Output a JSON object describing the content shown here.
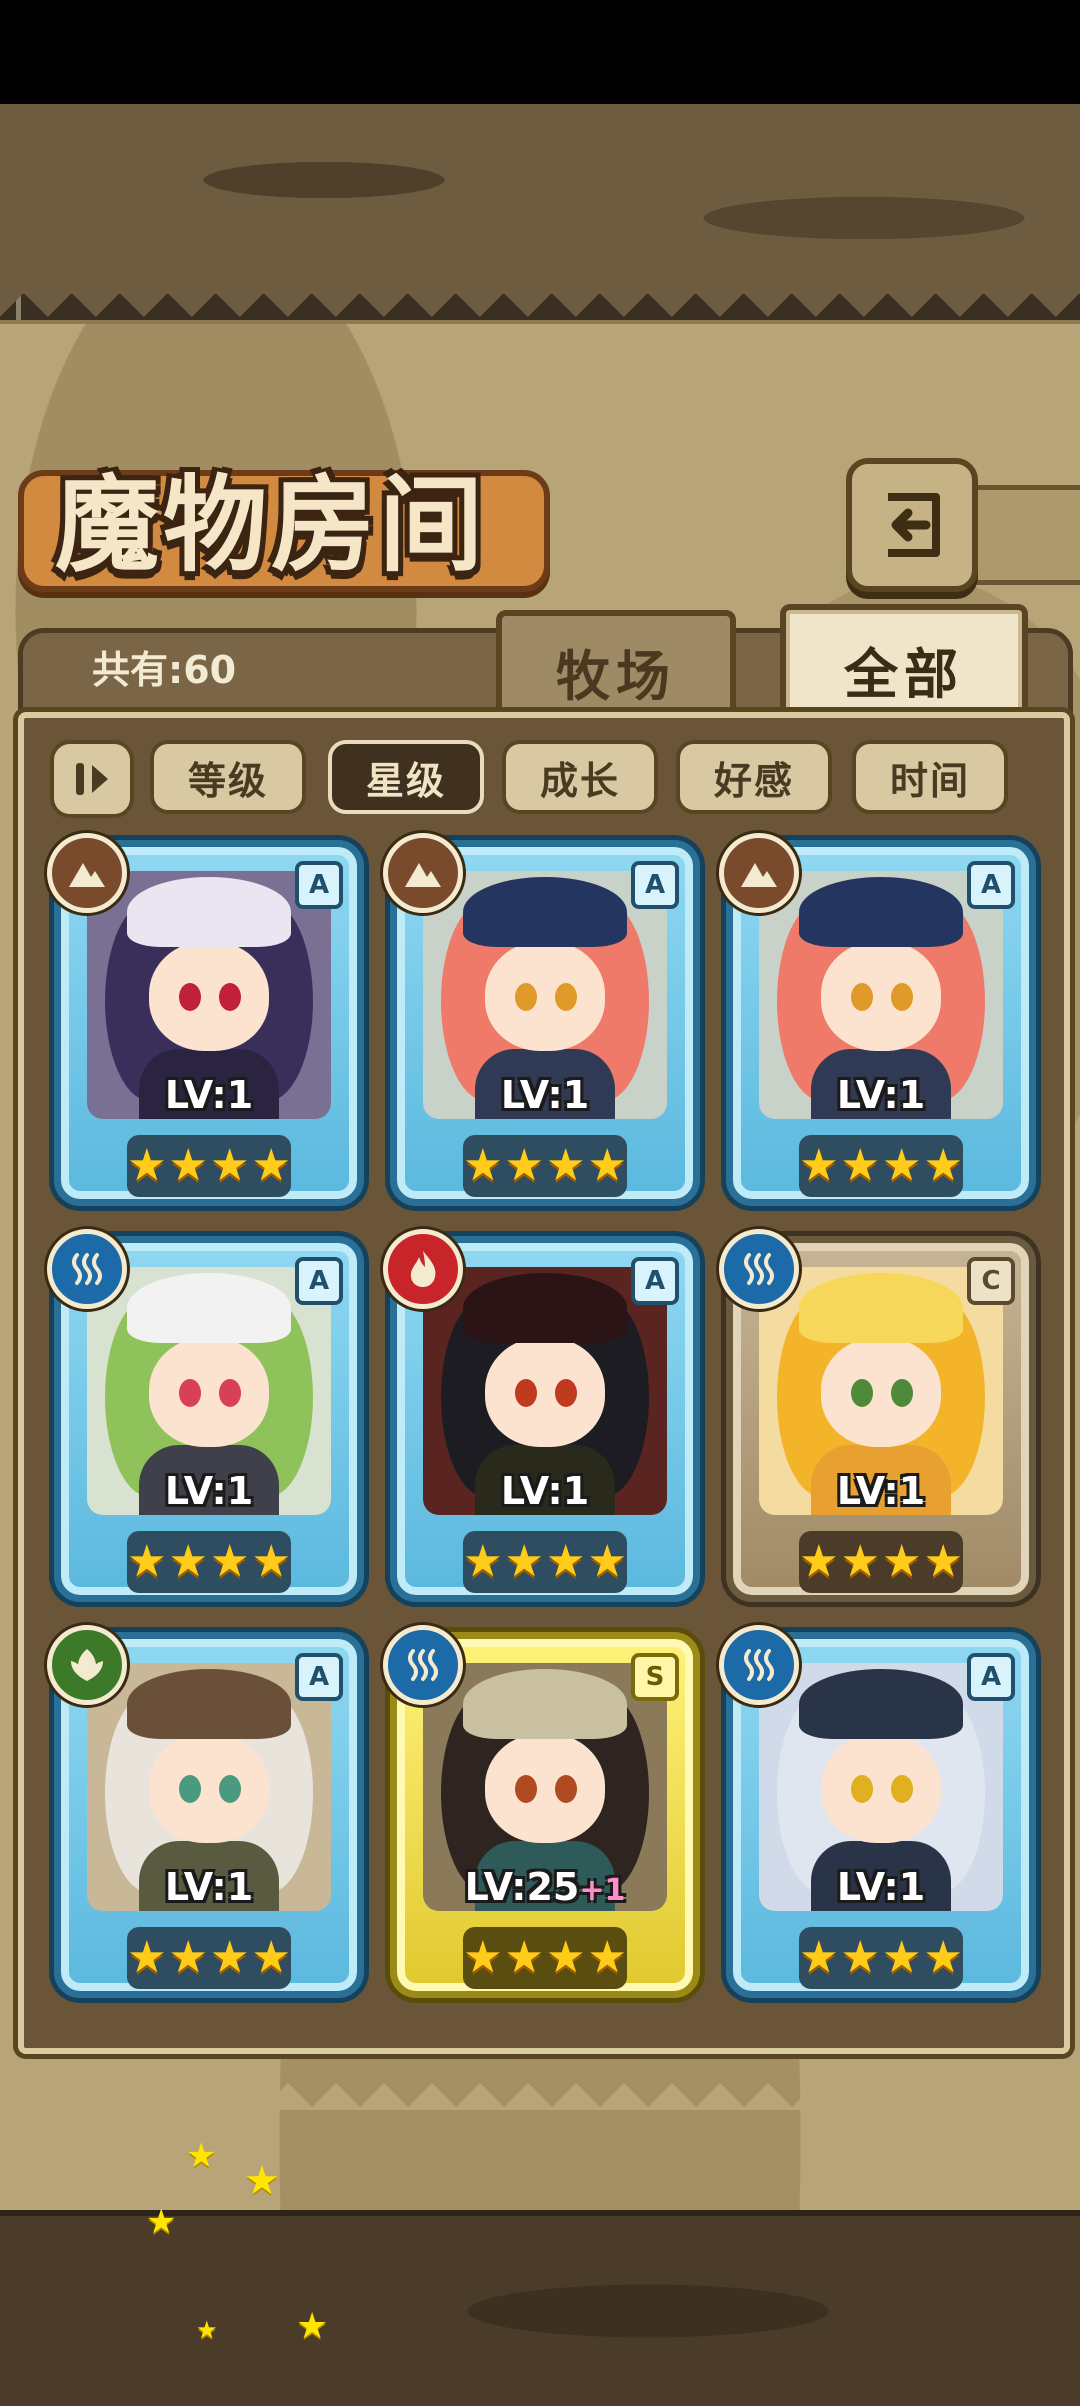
{
  "header": {
    "title": "魔物房间"
  },
  "summary": {
    "count_label": "共有:60"
  },
  "tabs": [
    {
      "label": "牧场",
      "selected": false
    },
    {
      "label": "全部",
      "selected": true
    }
  ],
  "sort": {
    "options": [
      {
        "label": "等级",
        "active": false
      },
      {
        "label": "星级",
        "active": true
      },
      {
        "label": "成长",
        "active": false
      },
      {
        "label": "好感",
        "active": false
      },
      {
        "label": "时间",
        "active": false
      }
    ]
  },
  "monsters": [
    {
      "level": "LV:1",
      "bonus": "",
      "rank": "A",
      "element": "earth-icon",
      "stars": 4,
      "frame": "blue"
    },
    {
      "level": "LV:1",
      "bonus": "",
      "rank": "A",
      "element": "earth-icon",
      "stars": 4,
      "frame": "blue"
    },
    {
      "level": "LV:1",
      "bonus": "",
      "rank": "A",
      "element": "earth-icon",
      "stars": 4,
      "frame": "blue"
    },
    {
      "level": "LV:1",
      "bonus": "",
      "rank": "A",
      "element": "water-icon",
      "stars": 4,
      "frame": "blue"
    },
    {
      "level": "LV:1",
      "bonus": "",
      "rank": "A",
      "element": "fire-icon",
      "stars": 4,
      "frame": "blue"
    },
    {
      "level": "LV:1",
      "bonus": "",
      "rank": "C",
      "element": "water-icon",
      "stars": 4,
      "frame": "bronze"
    },
    {
      "level": "LV:1",
      "bonus": "",
      "rank": "A",
      "element": "leaf-icon",
      "stars": 4,
      "frame": "blue"
    },
    {
      "level": "LV:25",
      "bonus": "+1",
      "rank": "S",
      "element": "water-icon",
      "stars": 4,
      "frame": "gold"
    },
    {
      "level": "LV:1",
      "bonus": "",
      "rank": "A",
      "element": "water-icon",
      "stars": 4,
      "frame": "blue"
    }
  ],
  "colors": {
    "earth": "#7a4a2c",
    "water": "#1c6aa8",
    "fire": "#c8252a",
    "leaf": "#3c7a2a",
    "star": "#ffcc1a"
  }
}
